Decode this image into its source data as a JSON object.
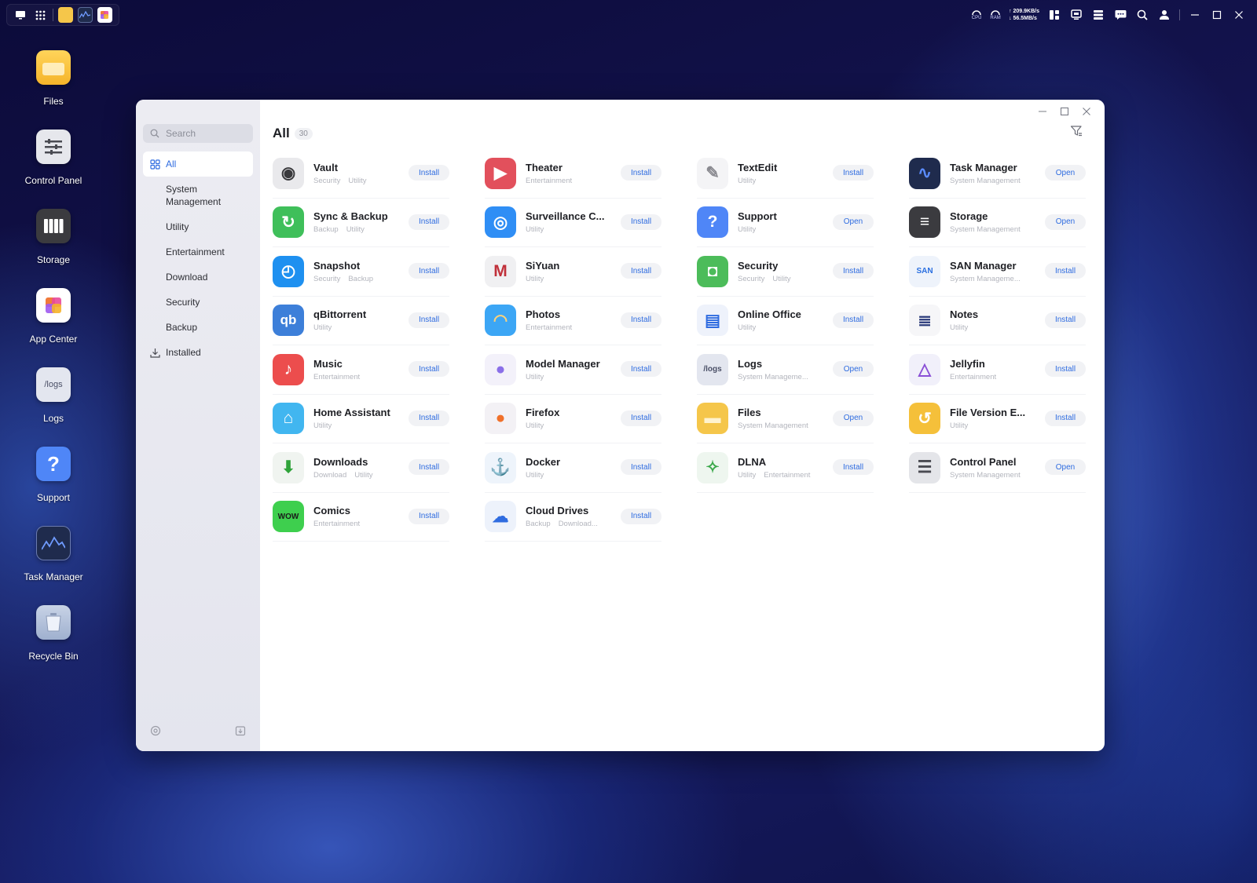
{
  "taskbar": {
    "left_icons": [
      "monitor-icon",
      "grid-icon",
      "files-app-icon",
      "task-manager-app-icon",
      "app-center-app-icon"
    ],
    "cpu_label": "CPU",
    "ram_label": "RAM",
    "upload_speed": "↑ 209.9KB/s",
    "download_speed": "↓ 56.5MB/s"
  },
  "desktop": {
    "items": [
      {
        "label": "Files",
        "icon": "folder-icon"
      },
      {
        "label": "Control Panel",
        "icon": "control-panel-icon"
      },
      {
        "label": "Storage",
        "icon": "storage-icon"
      },
      {
        "label": "App Center",
        "icon": "app-center-icon"
      },
      {
        "label": "Logs",
        "icon": "logs-icon",
        "icon_text": "/logs"
      },
      {
        "label": "Support",
        "icon": "support-icon",
        "icon_text": "?"
      },
      {
        "label": "Task Manager",
        "icon": "task-manager-icon"
      },
      {
        "label": "Recycle Bin",
        "icon": "recycle-bin-icon"
      }
    ]
  },
  "sidebar": {
    "search_placeholder": "Search",
    "items": [
      {
        "label": "All",
        "active": true
      },
      {
        "label": "System Management"
      },
      {
        "label": "Utility"
      },
      {
        "label": "Entertainment"
      },
      {
        "label": "Download"
      },
      {
        "label": "Security"
      },
      {
        "label": "Backup"
      },
      {
        "label": "Installed"
      }
    ]
  },
  "main": {
    "title": "All",
    "count": "30",
    "apps": [
      {
        "name": "Vault",
        "tags": [
          "Security",
          "Utility"
        ],
        "action": "Install",
        "color": "#e9e9ec",
        "glyph": "◉",
        "glyph_color": "#3a3a3d"
      },
      {
        "name": "Theater",
        "tags": [
          "Entertainment"
        ],
        "action": "Install",
        "color": "#e2505c",
        "glyph": "▶",
        "glyph_color": "#ffffff"
      },
      {
        "name": "TextEdit",
        "tags": [
          "Utility"
        ],
        "action": "Install",
        "color": "#f4f4f6",
        "glyph": "✎",
        "glyph_color": "#8a8a90"
      },
      {
        "name": "Task Manager",
        "tags": [
          "System Management"
        ],
        "action": "Open",
        "color": "#1f2b4d",
        "glyph": "∿",
        "glyph_color": "#5b8cff"
      },
      {
        "name": "Sync & Backup",
        "tags": [
          "Backup",
          "Utility"
        ],
        "action": "Install",
        "color": "#3fbf5a",
        "glyph": "↻",
        "glyph_color": "#ffffff"
      },
      {
        "name": "Surveillance C...",
        "tags": [
          "Utility"
        ],
        "action": "Install",
        "color": "#2f8ef5",
        "glyph": "◎",
        "glyph_color": "#ffffff"
      },
      {
        "name": "Support",
        "tags": [
          "Utility"
        ],
        "action": "Open",
        "color": "#4f86f7",
        "glyph": "?",
        "glyph_color": "#ffffff"
      },
      {
        "name": "Storage",
        "tags": [
          "System Management"
        ],
        "action": "Open",
        "color": "#3b3b3f",
        "glyph": "≡",
        "glyph_color": "#ffffff"
      },
      {
        "name": "Snapshot",
        "tags": [
          "Security",
          "Backup"
        ],
        "action": "Install",
        "color": "#1e90f0",
        "glyph": "◴",
        "glyph_color": "#ffffff"
      },
      {
        "name": "SiYuan",
        "tags": [
          "Utility"
        ],
        "action": "Install",
        "color": "#f0f0f2",
        "glyph": "M",
        "glyph_color": "#c0303a"
      },
      {
        "name": "Security",
        "tags": [
          "Security",
          "Utility"
        ],
        "action": "Install",
        "color": "#4cbc5a",
        "glyph": "◘",
        "glyph_color": "#ffffff"
      },
      {
        "name": "SAN Manager",
        "tags": [
          "System Manageme..."
        ],
        "action": "Install",
        "color": "#eef3fb",
        "glyph": "SAN",
        "glyph_color": "#2a6fe0"
      },
      {
        "name": "qBittorrent",
        "tags": [
          "Utility"
        ],
        "action": "Install",
        "color": "#3d7fd9",
        "glyph": "qb",
        "glyph_color": "#ffffff"
      },
      {
        "name": "Photos",
        "tags": [
          "Entertainment"
        ],
        "action": "Install",
        "color": "#3ca6f5",
        "glyph": "◠",
        "glyph_color": "#ffd27a"
      },
      {
        "name": "Online Office",
        "tags": [
          "Utility"
        ],
        "action": "Install",
        "color": "#eef2fb",
        "glyph": "▤",
        "glyph_color": "#2f6ce0"
      },
      {
        "name": "Notes",
        "tags": [
          "Utility"
        ],
        "action": "Install",
        "color": "#f6f6f8",
        "glyph": "≣",
        "glyph_color": "#2a3a7a"
      },
      {
        "name": "Music",
        "tags": [
          "Entertainment"
        ],
        "action": "Install",
        "color": "#ec4d4d",
        "glyph": "♪",
        "glyph_color": "#ffffff"
      },
      {
        "name": "Model Manager",
        "tags": [
          "Utility"
        ],
        "action": "Install",
        "color": "#f3f1fa",
        "glyph": "●",
        "glyph_color": "#8a6fe8"
      },
      {
        "name": "Logs",
        "tags": [
          "System Manageme..."
        ],
        "action": "Open",
        "color": "#e3e6ef",
        "glyph": "/logs",
        "glyph_color": "#4a4f66"
      },
      {
        "name": "Jellyfin",
        "tags": [
          "Entertainment"
        ],
        "action": "Install",
        "color": "#f1f0fa",
        "glyph": "△",
        "glyph_color": "#8a4fd6"
      },
      {
        "name": "Home Assistant",
        "tags": [
          "Utility"
        ],
        "action": "Install",
        "color": "#41b6f0",
        "glyph": "⌂",
        "glyph_color": "#ffffff"
      },
      {
        "name": "Firefox",
        "tags": [
          "Utility"
        ],
        "action": "Install",
        "color": "#f3f1f5",
        "glyph": "●",
        "glyph_color": "#f0702a"
      },
      {
        "name": "Files",
        "tags": [
          "System Management"
        ],
        "action": "Open",
        "color": "#f5c64a",
        "glyph": "▬",
        "glyph_color": "#fff3cf"
      },
      {
        "name": "File Version E...",
        "tags": [
          "Utility"
        ],
        "action": "Install",
        "color": "#f5c03a",
        "glyph": "↺",
        "glyph_color": "#ffffff"
      },
      {
        "name": "Downloads",
        "tags": [
          "Download",
          "Utility"
        ],
        "action": "Install",
        "color": "#f0f4f0",
        "glyph": "⬇",
        "glyph_color": "#2fa33a"
      },
      {
        "name": "Docker",
        "tags": [
          "Utility"
        ],
        "action": "Install",
        "color": "#eef4fb",
        "glyph": "⚓",
        "glyph_color": "#2496ed"
      },
      {
        "name": "DLNA",
        "tags": [
          "Utility",
          "Entertainment"
        ],
        "action": "Install",
        "color": "#eef6ef",
        "glyph": "✧",
        "glyph_color": "#3aa84a"
      },
      {
        "name": "Control Panel",
        "tags": [
          "System Management"
        ],
        "action": "Open",
        "color": "#e4e5e9",
        "glyph": "☰",
        "glyph_color": "#4a4b52"
      },
      {
        "name": "Comics",
        "tags": [
          "Entertainment"
        ],
        "action": "Install",
        "color": "#3ecf4e",
        "glyph": "WOW",
        "glyph_color": "#1a1a1a"
      },
      {
        "name": "Cloud Drives",
        "tags": [
          "Backup",
          "Download..."
        ],
        "action": "Install",
        "color": "#edf2fb",
        "glyph": "☁",
        "glyph_color": "#2f6ce0"
      }
    ]
  }
}
